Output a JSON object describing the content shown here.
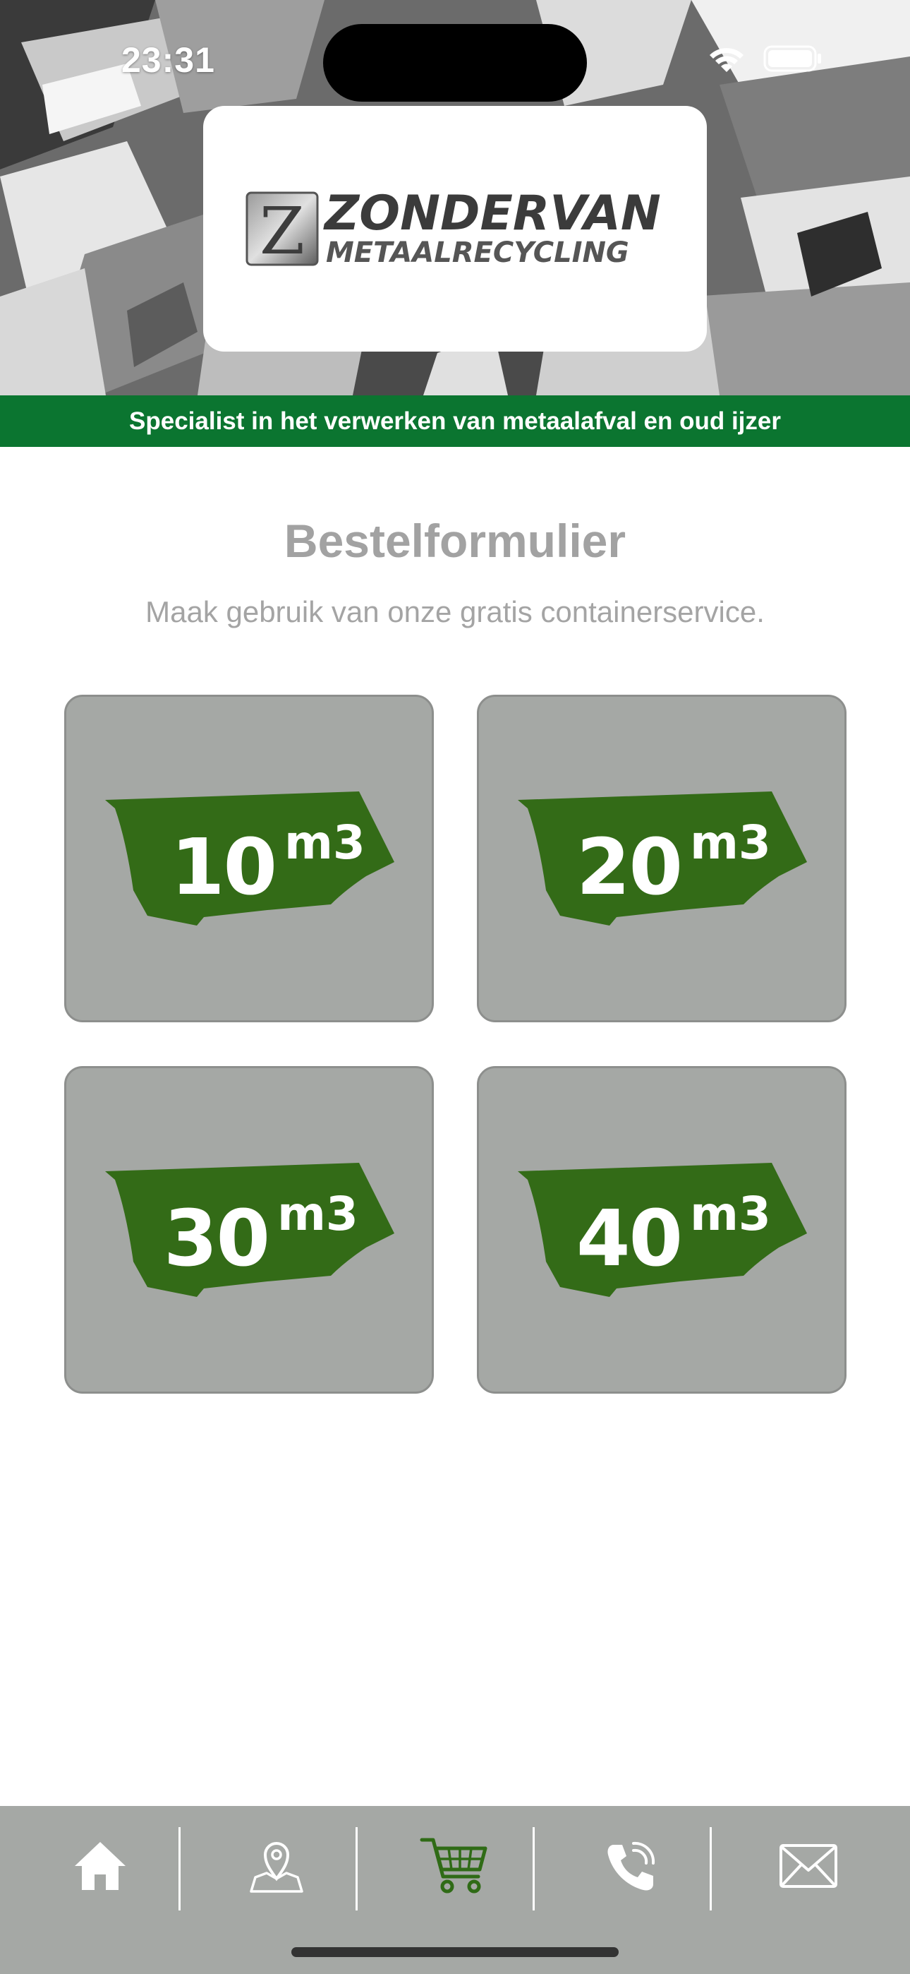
{
  "status_bar": {
    "time": "23:31",
    "wifi_icon": "wifi-icon",
    "battery_icon": "battery-icon"
  },
  "brand": {
    "name_line1": "ZONDERVAN",
    "name_line2": "METAALRECYCLING",
    "logo_letter": "Z"
  },
  "banner": {
    "text": "Specialist in het verwerken van metaalafval en oud ijzer",
    "color": "#0b7530"
  },
  "page": {
    "title": "Bestelformulier",
    "subtitle": "Maak gebruik van onze gratis containerservice."
  },
  "containers": [
    {
      "size": "10",
      "unit": "m3"
    },
    {
      "size": "20",
      "unit": "m3"
    },
    {
      "size": "30",
      "unit": "m3"
    },
    {
      "size": "40",
      "unit": "m3"
    }
  ],
  "colors": {
    "accent_green": "#336b17",
    "tile_gray": "#a5a8a5",
    "tabbar_gray": "#a5a8a5"
  },
  "tabbar": {
    "items": [
      {
        "icon": "home-icon",
        "active": false
      },
      {
        "icon": "map-pin-icon",
        "active": false
      },
      {
        "icon": "shopping-cart-icon",
        "active": true
      },
      {
        "icon": "phone-icon",
        "active": false
      },
      {
        "icon": "mail-icon",
        "active": false
      }
    ]
  }
}
